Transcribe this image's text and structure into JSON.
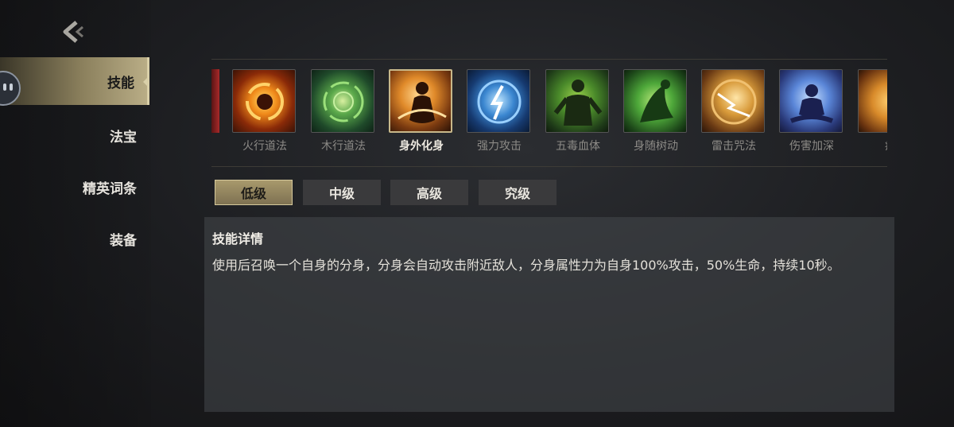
{
  "sidebar": {
    "items": [
      {
        "label": "技能",
        "active": true
      },
      {
        "label": "法宝",
        "active": false
      },
      {
        "label": "精英词条",
        "active": false
      },
      {
        "label": "装备",
        "active": false
      }
    ]
  },
  "skills": [
    {
      "name": "火行道法",
      "icon": "fire-vortex-icon"
    },
    {
      "name": "木行道法",
      "icon": "wood-vortex-icon"
    },
    {
      "name": "身外化身",
      "icon": "clone-figure-icon",
      "selected": true
    },
    {
      "name": "强力攻击",
      "icon": "lightning-rune-icon"
    },
    {
      "name": "五毒血体",
      "icon": "poison-body-icon"
    },
    {
      "name": "身随树动",
      "icon": "tree-figure-icon"
    },
    {
      "name": "雷击咒法",
      "icon": "thunder-spell-icon"
    },
    {
      "name": "伤害加深",
      "icon": "meditating-figure-icon"
    },
    {
      "name": "疾",
      "icon": "swift-icon"
    }
  ],
  "tiers": [
    {
      "label": "低级",
      "active": true
    },
    {
      "label": "中级"
    },
    {
      "label": "高级"
    },
    {
      "label": "究级"
    }
  ],
  "detail": {
    "title": "技能详情",
    "description": "使用后召唤一个自身的分身，分身会自动攻击附近敌人，分身属性力为自身100%攻击，50%生命，持续10秒。"
  },
  "colors": {
    "accent": "#b9ad86",
    "panel": "#46484c"
  }
}
